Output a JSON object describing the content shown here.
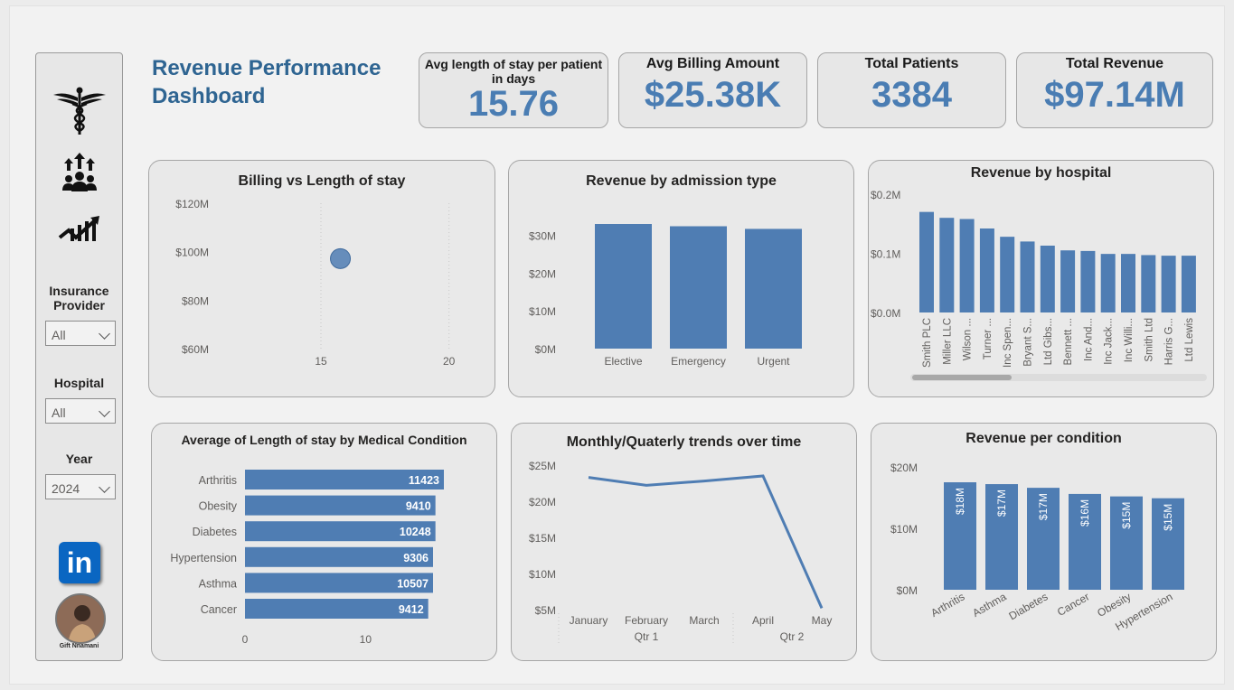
{
  "header": {
    "title_line1": "Revenue Performance",
    "title_line2": "Dashboard"
  },
  "kpis": [
    {
      "label": "Avg length of stay per patient in days",
      "value": "15.76"
    },
    {
      "label": "Avg Billing Amount",
      "value": "$25.38K"
    },
    {
      "label": "Total Patients",
      "value": "3384"
    },
    {
      "label": "Total Revenue",
      "value": "$97.14M"
    }
  ],
  "sidebar": {
    "nav_icons": [
      "caduceus-icon",
      "team-growth-icon",
      "trend-chart-icon"
    ],
    "filters": [
      {
        "label": "Insurance Provider",
        "value": "All"
      },
      {
        "label": "Hospital",
        "value": "All"
      },
      {
        "label": "Year",
        "value": "2024"
      }
    ],
    "profile_name": "Gift Nnamani",
    "linkedin_label": "in"
  },
  "colors": {
    "accent": "#4f7db3",
    "title": "#2f6592",
    "panel": "#e9e9e9"
  },
  "chart_data": [
    {
      "type": "scatter",
      "title": "Billing vs Length of stay",
      "points": [
        {
          "x": 15.76,
          "y": 97.14
        }
      ],
      "x_ticks": [
        "15",
        "20"
      ],
      "y_ticks": [
        "$120M",
        "$100M",
        "$80M",
        "$60M"
      ],
      "xlim": [
        12,
        21
      ],
      "ylim": [
        60,
        120
      ]
    },
    {
      "type": "bar",
      "title": "Revenue by admission type",
      "categories": [
        "Elective",
        "Emergency",
        "Urgent"
      ],
      "values": [
        33.0,
        32.4,
        31.7
      ],
      "y_ticks": [
        "$30M",
        "$20M",
        "$10M",
        "$0M"
      ],
      "ylim": [
        0,
        33
      ]
    },
    {
      "type": "bar",
      "title": "Revenue by hospital",
      "categories": [
        "Smith PLC",
        "Miller LLC",
        "Wilson ...",
        "Turner ...",
        "Inc Spen...",
        "Bryant S...",
        "Ltd Gibs...",
        "Bennett ...",
        "Inc And...",
        "Inc Jack...",
        "Inc Willi...",
        "Smith Ltd",
        "Harris G...",
        "Ltd Lewis"
      ],
      "values": [
        0.17,
        0.16,
        0.158,
        0.142,
        0.128,
        0.12,
        0.113,
        0.105,
        0.104,
        0.099,
        0.099,
        0.097,
        0.096,
        0.096
      ],
      "y_ticks": [
        "$0.2M",
        "$0.1M",
        "$0.0M"
      ],
      "ylim": [
        0,
        0.2
      ]
    },
    {
      "type": "bar",
      "orientation": "horizontal",
      "title": "Average of Length of stay by Medical Condition",
      "categories": [
        "Arthritis",
        "Obesity",
        "Diabetes",
        "Hypertension",
        "Asthma",
        "Cancer"
      ],
      "values": [
        11423,
        9410,
        10248,
        9306,
        10507,
        9412
      ],
      "bar_lengths": [
        16.5,
        15.8,
        15.8,
        15.6,
        15.6,
        15.2
      ],
      "x_ticks": [
        "0",
        "10"
      ],
      "xlim": [
        0,
        16.5
      ]
    },
    {
      "type": "line",
      "title": "Monthly/Quaterly trends over time",
      "x": [
        "January",
        "February",
        "March",
        "April",
        "May"
      ],
      "values": [
        23.3,
        22.2,
        22.8,
        23.5,
        5.2
      ],
      "quarters": [
        "Qtr 1",
        "Qtr 2"
      ],
      "y_ticks": [
        "$25M",
        "$20M",
        "$15M",
        "$10M",
        "$5M"
      ],
      "ylim": [
        5,
        25
      ]
    },
    {
      "type": "bar",
      "title": "Revenue per condition",
      "categories": [
        "Arthritis",
        "Asthma",
        "Diabetes",
        "Cancer",
        "Obesity",
        "Hypertension"
      ],
      "values": [
        17.5,
        17.2,
        16.6,
        15.6,
        15.2,
        14.9
      ],
      "data_labels": [
        "$18M",
        "$17M",
        "$17M",
        "$16M",
        "$15M",
        "$15M"
      ],
      "y_ticks": [
        "$20M",
        "$10M",
        "$0M"
      ],
      "ylim": [
        0,
        20
      ]
    }
  ]
}
